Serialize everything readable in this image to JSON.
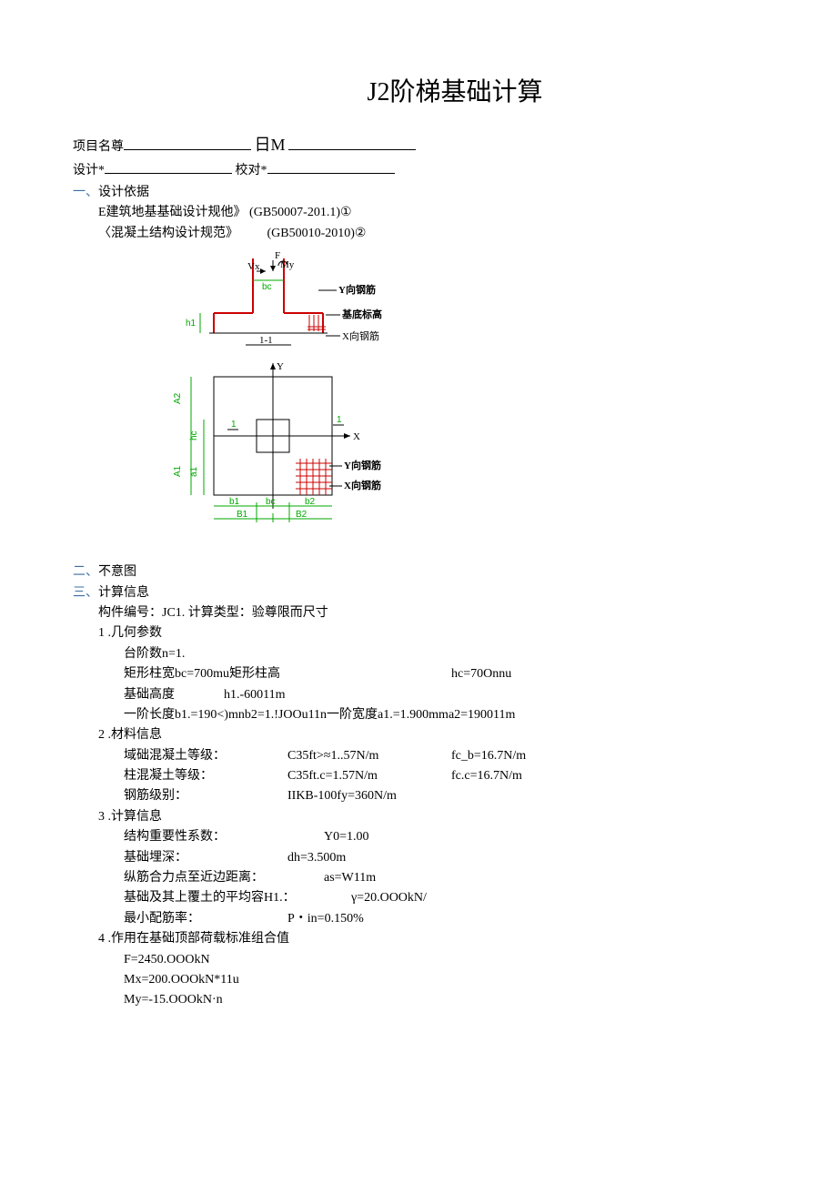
{
  "title": "J2阶梯基础计算",
  "header": {
    "project_label": "项目名尊",
    "date_label": "日M",
    "designer_label": "设计*",
    "checker_label": "校对*"
  },
  "sec1": {
    "num": "一、",
    "title": "设计依据",
    "ref1": "E建筑地基基础设计规他》 (GB50007-201.1)①",
    "ref2": "〈混凝土结构设计规范》",
    "ref2code": "(GB50010-2010)②"
  },
  "diagram": {
    "F": "F",
    "My": "My",
    "Vx": "Vx",
    "bc_top": "bc",
    "sec11": "1-1",
    "h1": "h1",
    "lbl_yrebar": "Y向钢筋",
    "lbl_baselevel": "基底标高",
    "lbl_xrebar": "X向钢筋",
    "Y": "Y",
    "X": "X",
    "A1": "A1",
    "A2": "A2",
    "a1": "a1",
    "hc": "hc",
    "b1": "b1",
    "bc": "bc",
    "b2": "b2",
    "B1": "B1",
    "B2": "B2",
    "one_l": "1",
    "one_r": "1",
    "lbl_yrebar2": "Y向钢筋",
    "lbl_xrebar2": "X向钢筋"
  },
  "sec2": {
    "num": "二、",
    "title": "不意图"
  },
  "sec3": {
    "num": "三、",
    "title": "计算信息",
    "line0": "构件编号：JC1.          计算类型：验尊限而尺寸",
    "h1": "1 .几何参数",
    "g_steps": "台阶数n=1.",
    "g_bc": "矩形柱宽bc=700mu矩形柱高",
    "g_hc": "hc=70Onnu",
    "g_h1a": "基础高度",
    "g_h1b": "h1.-60011m",
    "g_b": "一阶长度b1.=190<)mnb2=1.!JOOu11n一阶宽度a1.=1.900mma2=190011m",
    "h2": "2 .材料信息",
    "m_r1a": "域础混凝土等级：",
    "m_r1b": "C35ft>≈1..57N/m",
    "m_r1c": "fc_b=16.7N/m",
    "m_r2a": "柱混凝土等级：",
    "m_r2b": "C35ft.c=1.57N/m",
    "m_r2c": "fc.c=16.7N/m",
    "m_r3a": "钢筋级别：",
    "m_r3b": "IIKB-100fy=360N/m",
    "h3": "3 .计算信息",
    "c_r1a": "结构重要性系数：",
    "c_r1b": "Y0=1.00",
    "c_r2a": "基础埋深：",
    "c_r2b": "dh=3.500m",
    "c_r3a": "纵筋合力点至近边距离：",
    "c_r3b": "as=W11m",
    "c_r4a": "基础及其上覆土的平均容H1.：",
    "c_r4b": "γ=20.OOOkN/",
    "c_r5a": "最小配筋率：",
    "c_r5b": "P・in=0.150%",
    "h4": "4 .作用在基础顶部荷载标准组合值",
    "l_f": "F=2450.OOOkN",
    "l_mx": "Mx=200.OOOkN*11u",
    "l_my": "My=-15.OOOkN·n"
  }
}
